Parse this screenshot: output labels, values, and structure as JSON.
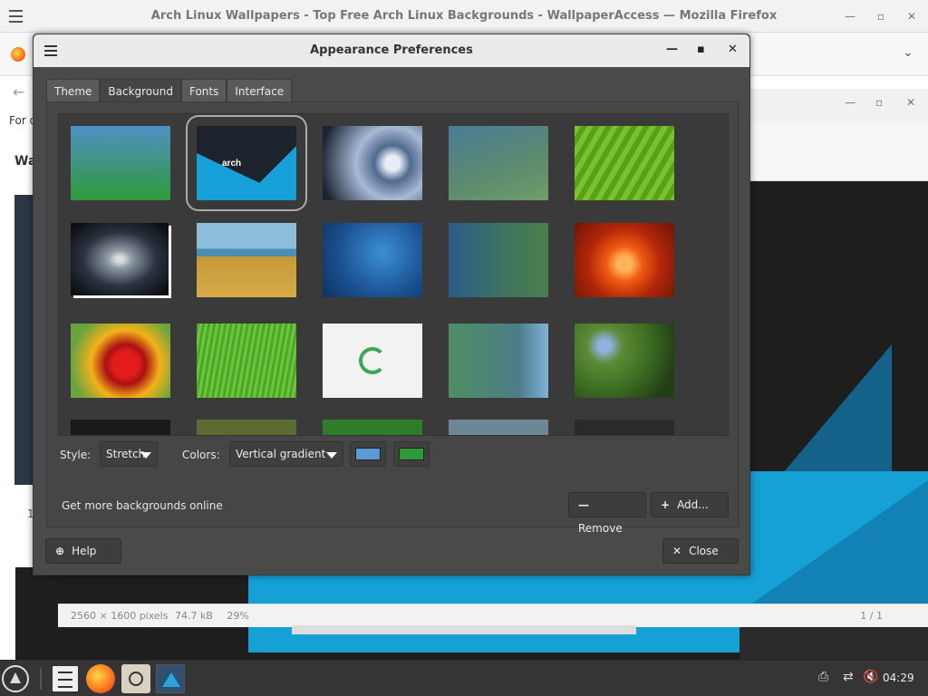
{
  "firefox": {
    "title": "Arch Linux Wallpapers - Top Free Arch Linux Backgrounds - WallpaperAccess — Mozilla Firefox",
    "page_text_1": "For q",
    "page_text_2": "Wa",
    "page_text_3": "1"
  },
  "viewer": {
    "dimensions": "2560 × 1600 pixels",
    "filesize": "74.7 kB",
    "zoom": "29%",
    "page": "1 / 1"
  },
  "dialog": {
    "title": "Appearance Preferences",
    "tabs": [
      {
        "label": "Theme",
        "active": false
      },
      {
        "label": "Background",
        "active": true
      },
      {
        "label": "Fonts",
        "active": false
      },
      {
        "label": "Interface",
        "active": false
      }
    ],
    "style_label": "Style:",
    "style_value": "Stretch",
    "colors_label": "Colors:",
    "colors_value": "Vertical gradient",
    "color1": "#5b9bd5",
    "color2": "#2f9a3a",
    "get_more": "Get more backgrounds online",
    "remove_label": "Remove",
    "add_label": "Add...",
    "help_label": "Help",
    "close_label": "Close",
    "arch_logo_text": "arch"
  },
  "taskbar": {
    "clock": "04:29"
  }
}
